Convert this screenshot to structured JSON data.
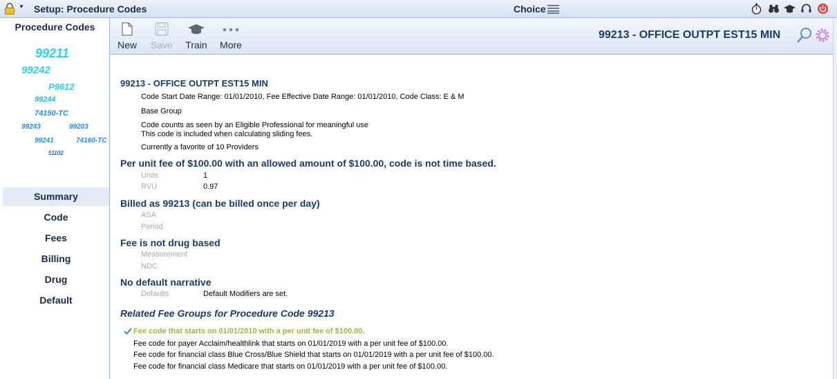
{
  "titlebar": {
    "title": "Setup: Procedure Codes",
    "choice": "Choice",
    "icons": [
      "lock-icon",
      "stopwatch-icon",
      "binoculars-icon",
      "graduation-cap-icon",
      "headset-icon",
      "power-icon"
    ]
  },
  "sidebar": {
    "title": "Procedure Codes",
    "cloud": [
      "99211",
      "99242",
      "P9612",
      "99244",
      "74150-TC",
      "99243",
      "99203",
      "99241",
      "74160-TC",
      "51102"
    ],
    "nav": [
      "Summary",
      "Code",
      "Fees",
      "Billing",
      "Drug",
      "Default"
    ],
    "active": "Summary"
  },
  "toolbar": {
    "new_label": "New",
    "save_label": "Save",
    "train_label": "Train",
    "more_label": "More",
    "heading": "99213 - OFFICE OUTPT EST15 MIN"
  },
  "main": {
    "title": "99213 - OFFICE OUTPT EST15 MIN",
    "line1": "Code Start Date Range: 01/01/2010, Fee Effective Date Range: 01/01/2010, Code Class: E & M",
    "group": "Base Group",
    "meaningful": "Code counts as seen by an Eligible Professional for meaningful use",
    "sliding": "This code is included when calculating sliding fees.",
    "favorite": "Currently a favorite of 10 Providers",
    "fee_heading": "Per unit fee of $100.00 with an allowed amount of $100.00, code is not time based.",
    "units_label": "Units",
    "units_value": "1",
    "rvu_label": "RVU",
    "rvu_value": "0.97",
    "billed_heading": "Billed as 99213 (can be billed once per day)",
    "asa_label": "ASA",
    "period_label": "Period",
    "drug_heading": "Fee is not drug based",
    "measurement_label": "Measurement",
    "ndc_label": "NDC",
    "narrative_heading": "No default narrative",
    "defaults_label": "Defaults",
    "defaults_value": "Default Modifiers are set.",
    "related_heading": "Related Fee Groups for Procedure Code 99213",
    "fee_groups": [
      "Fee code that starts on 01/01/2010 with a per unit fee of $100.00.",
      "Fee code for payer Acclaim/healthlink that starts on 01/01/2019 with a per unit fee of $100.00.",
      "Fee code for financial class Blue Cross/Blue Shield that starts on 01/01/2019 with a per unit fee of $100.00.",
      "Fee code for financial class Medicare that starts on 01/01/2019 with a per unit fee of $100.00."
    ]
  },
  "colors": {
    "accent": "#1b3a66",
    "cloud_cyan": "#2ad3e8",
    "cloud_blue": "#1e90e6",
    "active_fee": "#9ab843"
  }
}
